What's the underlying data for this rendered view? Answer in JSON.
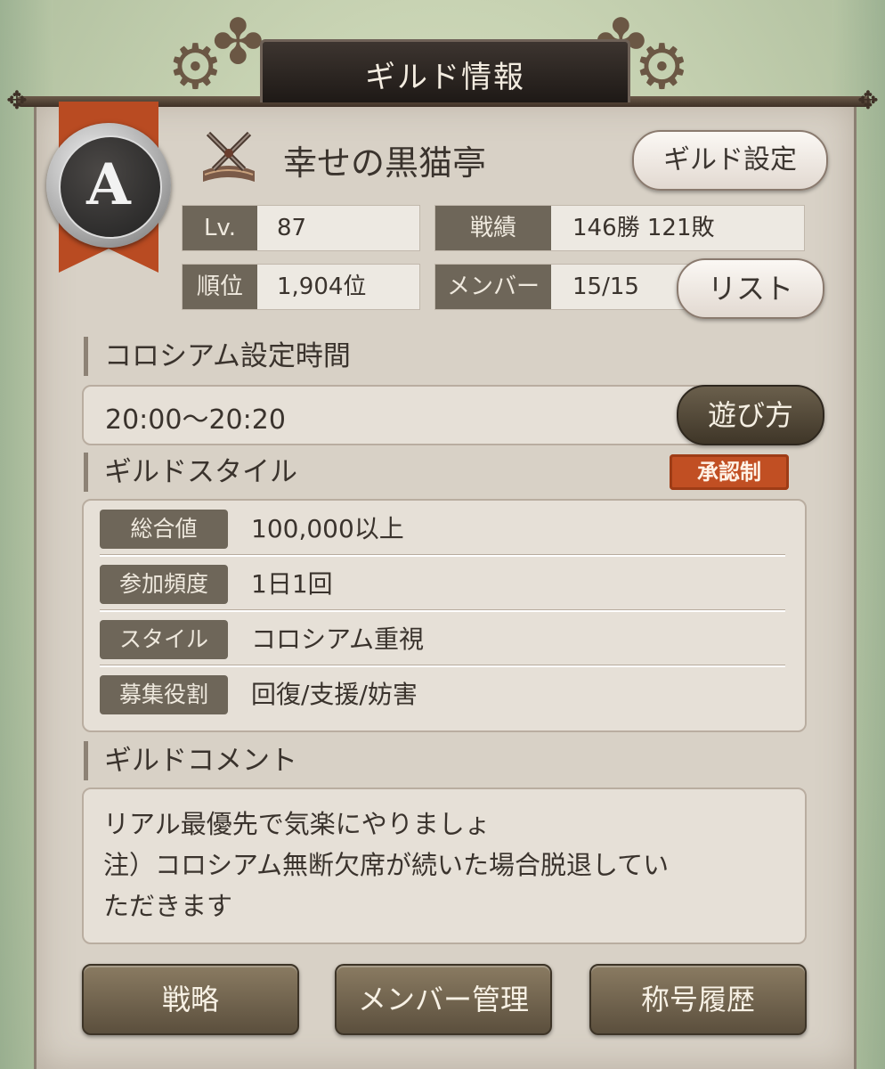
{
  "title": "ギルド情報",
  "guild": {
    "rank": "A",
    "name": "幸せの黒猫亭",
    "settings_button": "ギルド設定"
  },
  "stats": {
    "level_label": "Lv.",
    "level_value": "87",
    "record_label": "戦績",
    "record_value": "146勝 121敗",
    "rank_label": "順位",
    "rank_value": "1,904位",
    "members_label": "メンバー",
    "members_value": "15/15",
    "list_button": "リスト"
  },
  "colosseum": {
    "heading": "コロシアム設定時間",
    "time": "20:00～20:20",
    "howto_button": "遊び方"
  },
  "guild_style": {
    "heading": "ギルドスタイル",
    "badge": "承認制",
    "rows": [
      {
        "label": "総合値",
        "value": "100,000以上"
      },
      {
        "label": "参加頻度",
        "value": "1日1回"
      },
      {
        "label": "スタイル",
        "value": "コロシアム重視"
      },
      {
        "label": "募集役割",
        "value": "回復/支援/妨害"
      }
    ]
  },
  "comment": {
    "heading": "ギルドコメント",
    "lines": [
      "リアル最優先で気楽にやりましょ",
      "注）コロシアム無断欠席が続いた場合脱退してい",
      "ただきます"
    ]
  },
  "bottom_buttons": {
    "strategy": "戦略",
    "member_management": "メンバー管理",
    "title_history": "称号履歴"
  },
  "colors": {
    "panel": "#d8d1c6",
    "label_bg": "#6e6659",
    "badge": "#c14f23",
    "button": "#7a6c55"
  }
}
